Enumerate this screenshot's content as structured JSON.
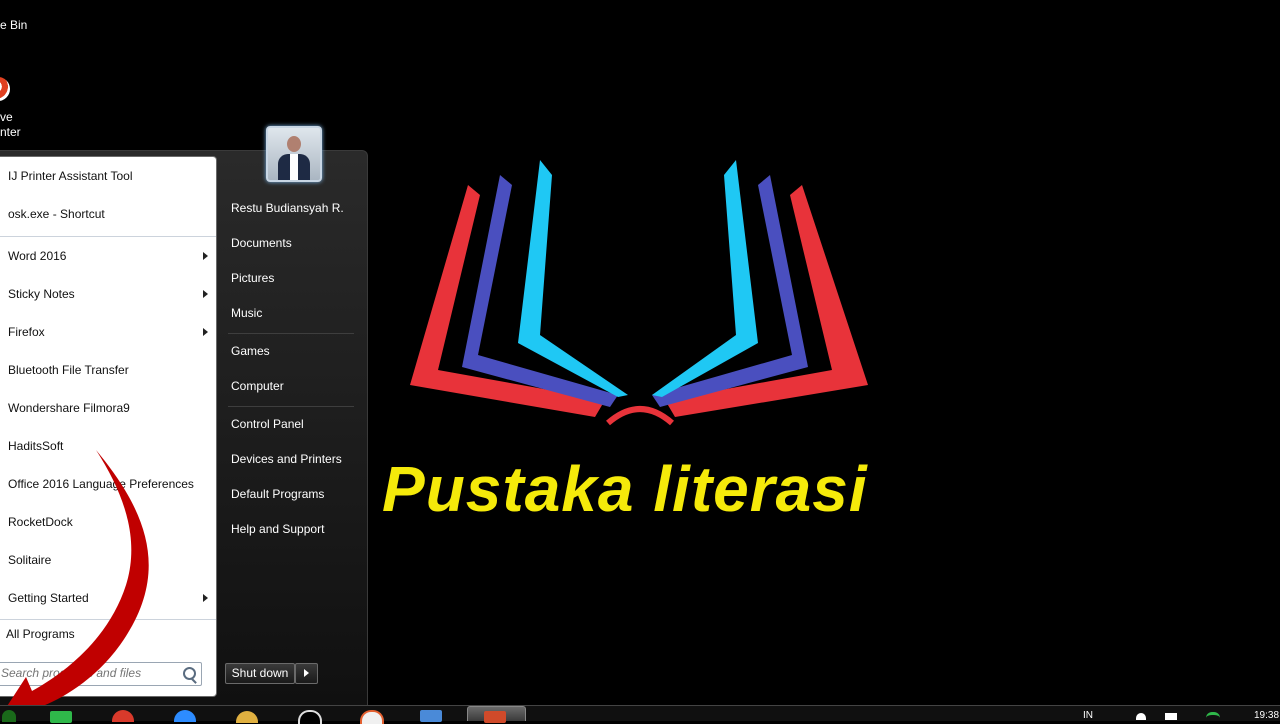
{
  "desktop": {
    "icons": [
      {
        "label": "e Bin",
        "icon": "recycle-bin-icon"
      },
      {
        "label": "ve\nnter",
        "icon": "printer-app-icon"
      }
    ]
  },
  "start_menu": {
    "pinned": [
      {
        "label": "IJ Printer Assistant Tool"
      },
      {
        "label": "osk.exe - Shortcut"
      }
    ],
    "programs": [
      {
        "label": "Word 2016",
        "submenu": true
      },
      {
        "label": "Sticky Notes",
        "submenu": true
      },
      {
        "label": "Firefox",
        "submenu": true
      },
      {
        "label": "Bluetooth File Transfer",
        "submenu": false
      },
      {
        "label": "Wondershare Filmora9",
        "submenu": false
      },
      {
        "label": "HaditsSoft",
        "submenu": false
      },
      {
        "label": "Office 2016 Language Preferences",
        "submenu": false
      },
      {
        "label": "RocketDock",
        "submenu": false
      },
      {
        "label": "Solitaire",
        "submenu": false
      },
      {
        "label": "Getting Started",
        "submenu": true
      }
    ],
    "all_programs_label": "All Programs",
    "search_placeholder": "Search programs and files",
    "right_links": [
      "Restu Budiansyah R.",
      "Documents",
      "Pictures",
      "Music",
      "Games",
      "Computer",
      "Control Panel",
      "Devices and Printers",
      "Default Programs",
      "Help and Support"
    ],
    "shutdown_label": "Shut down"
  },
  "wallpaper": {
    "logo_text": "Pustaka literasi",
    "colors": {
      "red": "#e8333a",
      "blue": "#4a4fbf",
      "cyan": "#1fc8f4",
      "yellow": "#f5ea0a"
    }
  },
  "taskbar": {
    "tray_lang": "IN",
    "clock": "19:38"
  }
}
